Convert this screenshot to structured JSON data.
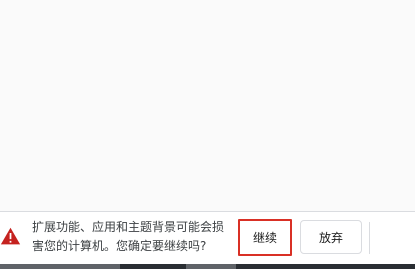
{
  "warning_bar": {
    "icon": "warning-triangle-icon",
    "message_line1": "扩展功能、应用和主题背景可能会损",
    "message_line2": "害您的计算机。您确定要继续吗?",
    "continue_label": "继续",
    "discard_label": "放弃"
  },
  "colors": {
    "warning_icon": "#c5221f",
    "focus_border": "#d93025"
  }
}
